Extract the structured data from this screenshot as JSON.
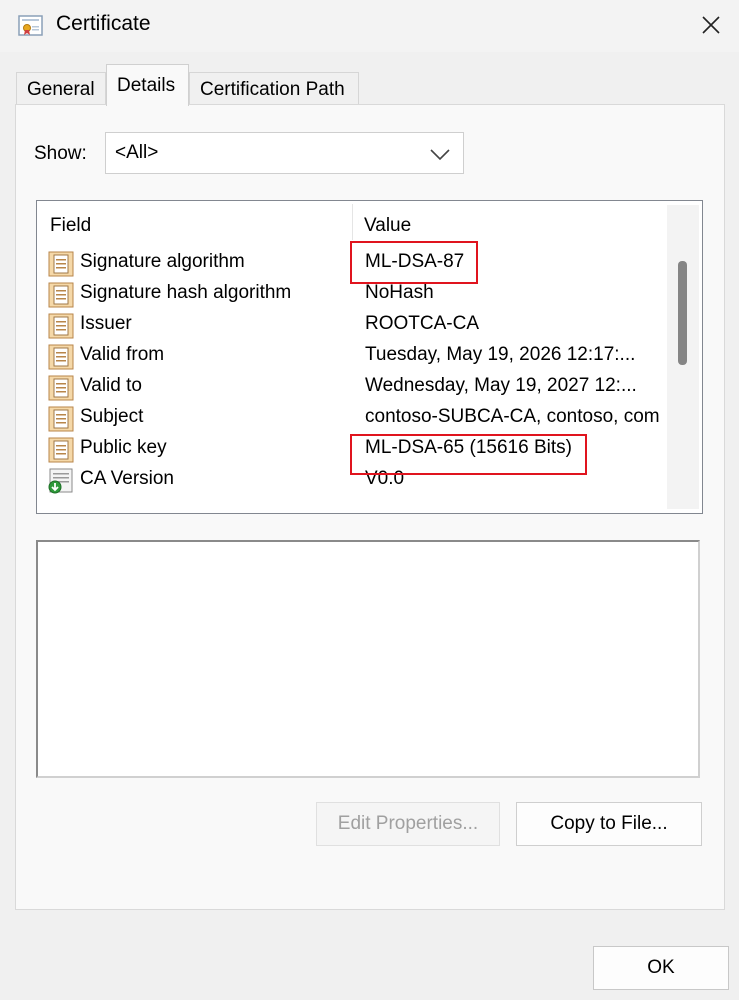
{
  "window": {
    "title": "Certificate"
  },
  "tabs": [
    {
      "label": "General"
    },
    {
      "label": "Details"
    },
    {
      "label": "Certification Path"
    }
  ],
  "show": {
    "label": "Show:",
    "value": "<All>"
  },
  "list": {
    "columns": [
      "Field",
      "Value"
    ],
    "rows": [
      {
        "field": "Signature algorithm",
        "value": "ML-DSA-87",
        "icon": "cert-field-icon",
        "highlighted": true
      },
      {
        "field": "Signature hash algorithm",
        "value": "NoHash",
        "icon": "cert-field-icon"
      },
      {
        "field": "Issuer",
        "value": "ROOTCA-CA",
        "icon": "cert-field-icon"
      },
      {
        "field": "Valid from",
        "value": "Tuesday, May 19, 2026 12:17:...",
        "icon": "cert-field-icon"
      },
      {
        "field": "Valid to",
        "value": "Wednesday, May 19, 2027 12:...",
        "icon": "cert-field-icon"
      },
      {
        "field": "Subject",
        "value": "contoso-SUBCA-CA, contoso, com",
        "icon": "cert-field-icon"
      },
      {
        "field": "Public key",
        "value": "ML-DSA-65 (15616 Bits)",
        "icon": "cert-field-icon",
        "highlighted": true
      },
      {
        "field": "CA Version",
        "value": "V0.0",
        "icon": "extension-icon"
      }
    ]
  },
  "buttons": {
    "edit_properties": "Edit Properties...",
    "copy_to_file": "Copy to File...",
    "ok": "OK"
  },
  "colors": {
    "highlight_border": "#e0141e"
  }
}
